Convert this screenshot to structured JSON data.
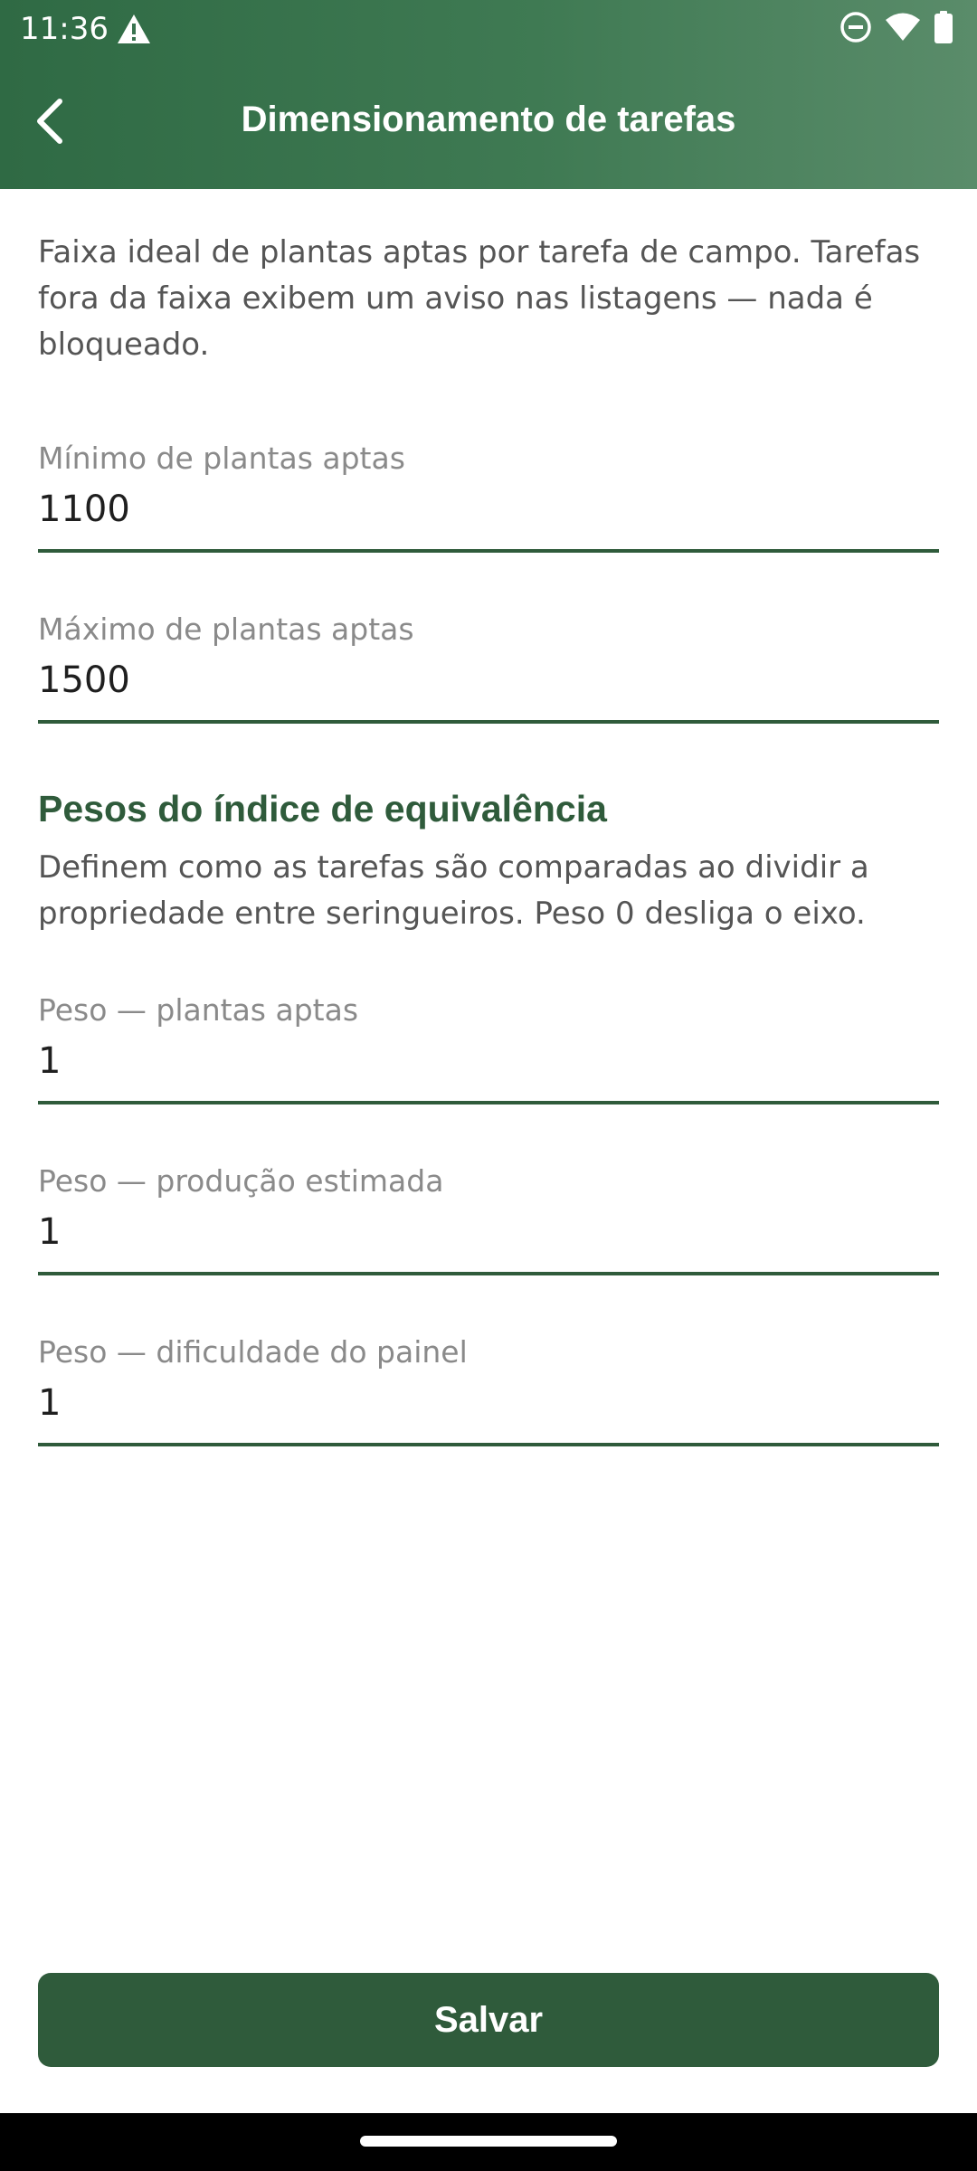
{
  "status_bar": {
    "time": "11:36",
    "icons": [
      "warning-icon",
      "do-not-disturb-icon",
      "wifi-icon",
      "battery-icon"
    ]
  },
  "app_bar": {
    "title": "Dimensionamento de tarefas",
    "back_icon": "chevron-left-icon"
  },
  "intro_text": "Faixa ideal de plantas aptas por tarefa de campo. Tarefas fora da faixa exibem um aviso nas listagens — nada é bloqueado.",
  "range_fields": [
    {
      "label": "Mínimo de plantas aptas",
      "value": "1100"
    },
    {
      "label": "Máximo de plantas aptas",
      "value": "1500"
    }
  ],
  "weights_section": {
    "title": "Pesos do índice de equivalência",
    "description": "Definem como as tarefas são comparadas ao dividir a propriedade entre seringueiros. Peso 0 desliga o eixo.",
    "fields": [
      {
        "label": "Peso — plantas aptas",
        "value": "1"
      },
      {
        "label": "Peso — produção estimada",
        "value": "1"
      },
      {
        "label": "Peso — dificuldade do painel",
        "value": "1"
      }
    ]
  },
  "save_button_label": "Salvar",
  "colors": {
    "primary": "#2f5b3b",
    "header": "#3f7a53",
    "text_muted": "#555555",
    "label": "#8a8a8a"
  }
}
